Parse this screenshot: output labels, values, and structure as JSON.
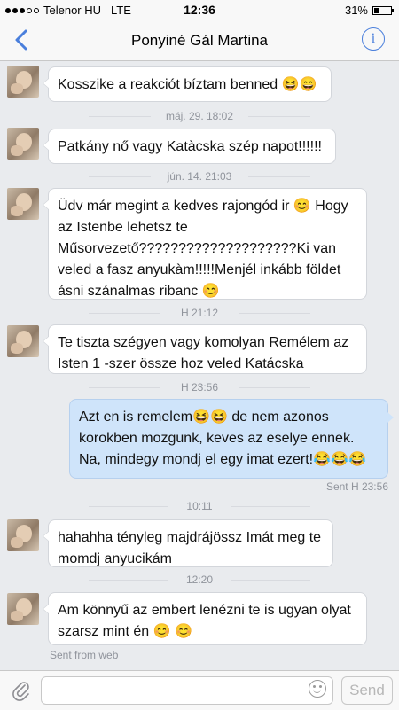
{
  "status": {
    "carrier": "Telenor HU",
    "network": "LTE",
    "time": "12:36",
    "battery": "31%",
    "battery_level": 0.31
  },
  "header": {
    "title": "Ponyiné Gál Martina"
  },
  "messages": [
    {
      "text": "Kosszike a reakciót bíztam benned 😆😄"
    },
    {
      "text": "Patkány nő vagy Katàcska szép napot!!!!!!"
    },
    {
      "text": "Üdv már megint a kedves rajongód ir 😊 Hogy az Istenbe lehetsz te Műsorvezető????????????????????Ki van veled a fasz anyukàm!!!!!Menjél inkább földet ásni szánalmas ribanc 😊"
    },
    {
      "text": "Te tiszta szégyen vagy komolyan Remélem az Isten 1 -szer össze hoz veled Katácska"
    },
    {
      "text": "Azt en is remelem😆😆 de nem azonos korokben mozgunk, keves az eselye ennek. Na, mindegy mondj el egy imat ezert!😂😂😂"
    },
    {
      "text": "hahahha tényleg majdrájössz Imát meg te momdj anyucikám"
    },
    {
      "text": "Am könnyű az embert lenézni te is ugyan olyat szarsz mint én 😊 😊"
    }
  ],
  "timestamps": [
    "máj. 29. 18:02",
    "jún. 14. 21:03",
    "H 21:12",
    "H 23:56",
    "10:11",
    "12:20"
  ],
  "sent_status": "Sent H 23:56",
  "sent_from": "Sent from web",
  "composer": {
    "placeholder": "",
    "send_label": "Send"
  },
  "colors": {
    "accent": "#4a7fdc",
    "outgoing_bubble": "#cfe4fa",
    "background": "#e9ebee"
  }
}
